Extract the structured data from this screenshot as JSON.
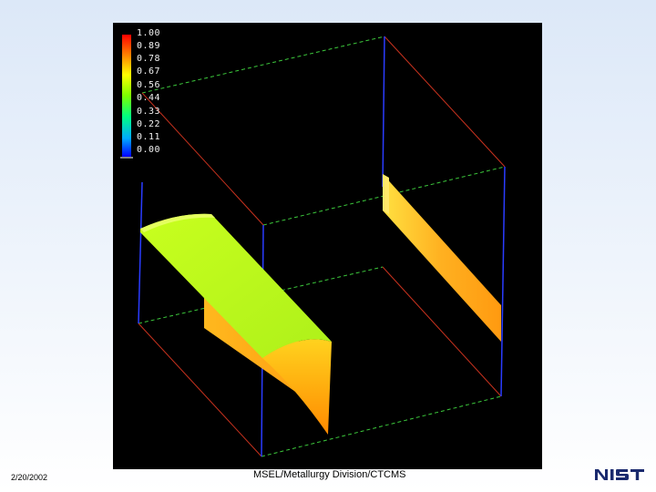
{
  "legend": {
    "labels": [
      "1.00",
      "0.89",
      "0.78",
      "0.67",
      "0.56",
      "0.44",
      "0.33",
      "0.22",
      "0.11",
      "0.00"
    ]
  },
  "footer": {
    "date": "2/20/2002",
    "center": "MSEL/Metallurgy Division/CTCMS",
    "logo_text": "NIST"
  },
  "colors": {
    "background_top": "#dce8f8",
    "background_bottom": "#ffffff",
    "viz_background": "#000000",
    "edge_red": "#c8321e",
    "edge_green": "#3cc83c",
    "edge_blue": "#2a3cff",
    "logo_blue": "#1a2a6e"
  }
}
